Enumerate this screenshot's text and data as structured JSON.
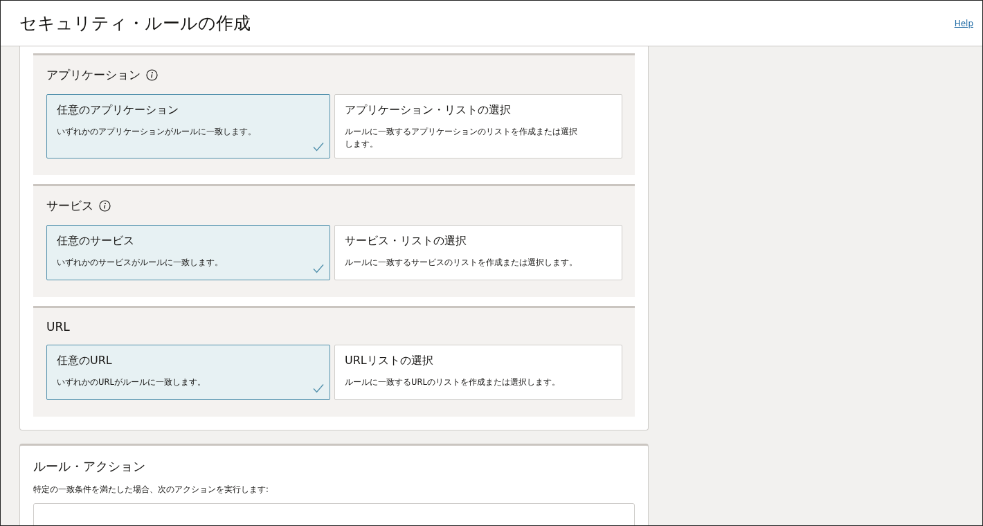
{
  "header": {
    "title": "セキュリティ・ルールの作成",
    "help_link": "Help"
  },
  "match_sections": [
    {
      "title": "アプリケーション",
      "info": true,
      "options": [
        {
          "title": "任意のアプリケーション",
          "description": "いずれかのアプリケーションがルールに一致します。",
          "selected": true
        },
        {
          "title": "アプリケーション・リストの選択",
          "description": "ルールに一致するアプリケーションのリストを作成または選択します。",
          "selected": false
        }
      ]
    },
    {
      "title": "サービス",
      "info": true,
      "options": [
        {
          "title": "任意のサービス",
          "description": "いずれかのサービスがルールに一致します。",
          "selected": true
        },
        {
          "title": "サービス・リストの選択",
          "description": "ルールに一致するサービスのリストを作成または選択します。",
          "selected": false
        }
      ]
    },
    {
      "title": "URL",
      "info": false,
      "options": [
        {
          "title": "任意のURL",
          "description": "いずれかのURLがルールに一致します。",
          "selected": true
        },
        {
          "title": "URLリストの選択",
          "description": "ルールに一致するURLのリストを作成または選択します。",
          "selected": false
        }
      ]
    }
  ],
  "rule_action": {
    "title": "ルール・アクション",
    "description": "特定の一致条件を満たした場合、次のアクションを実行します:"
  }
}
